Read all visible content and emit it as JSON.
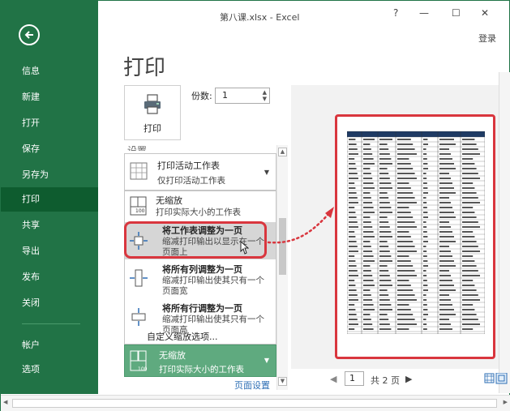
{
  "window": {
    "title": "第八课.xlsx - Excel",
    "help": "?",
    "minimize": "—",
    "maximize": "☐",
    "close": "✕",
    "login": "登录"
  },
  "sidebar": {
    "items": [
      {
        "label": "信息"
      },
      {
        "label": "新建"
      },
      {
        "label": "打开"
      },
      {
        "label": "保存"
      },
      {
        "label": "另存为"
      },
      {
        "label": "打印"
      },
      {
        "label": "共享"
      },
      {
        "label": "导出"
      },
      {
        "label": "发布"
      },
      {
        "label": "关闭"
      }
    ],
    "bottom_items": [
      {
        "label": "帐户"
      },
      {
        "label": "选项"
      }
    ]
  },
  "page": {
    "title": "打印",
    "print_button": "打印",
    "copies_label": "份数:",
    "copies_value": "1"
  },
  "settings": {
    "cut_label": "设置",
    "active_sheets": {
      "title": "打印活动工作表",
      "subtitle": "仅打印活动工作表"
    },
    "options": [
      {
        "title": "无缩放",
        "subtitle": "打印实际大小的工作表"
      },
      {
        "title": "将工作表调整为一页",
        "subtitle1": "缩减打印输出以显示在一个",
        "subtitle2": "页面上"
      },
      {
        "title": "将所有列调整为一页",
        "subtitle1": "缩减打印输出使其只有一个",
        "subtitle2": "页面宽"
      },
      {
        "title": "将所有行调整为一页",
        "subtitle1": "缩减打印输出使其只有一个",
        "subtitle2": "页面高"
      }
    ],
    "custom_scaling": "自定义缩放选项...",
    "selected": {
      "title": "无缩放",
      "subtitle": "打印实际大小的工作表",
      "icon_number": "100"
    },
    "page_setup": "页面设置",
    "icon_number": "100"
  },
  "preview": {
    "page_value": "1",
    "page_total": "共 2 页",
    "next_arrow": "▶",
    "prev_arrow": "◀"
  },
  "colors": {
    "sidebar": "#217346",
    "sidebar_active": "#0e5c2f",
    "highlight_red": "#d9363e",
    "selected_green": "#5faa7f",
    "link_blue": "#2e6fb5"
  }
}
